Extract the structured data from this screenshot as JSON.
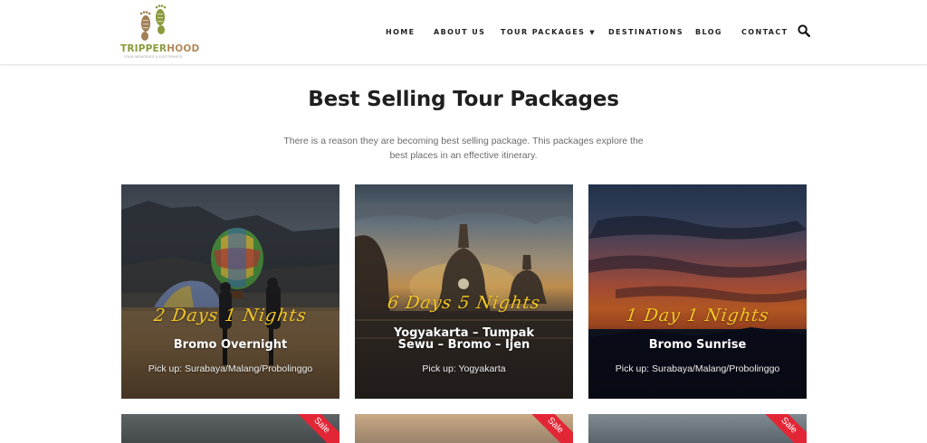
{
  "header": {
    "logo": {
      "name_part1": "TRIPPER",
      "name_part2": "HOOD",
      "tagline": "YOUR MEMORIES & FOOTPRINTS"
    },
    "nav": [
      {
        "label": "HOME"
      },
      {
        "label": "ABOUT US"
      },
      {
        "label": "TOUR PACKAGES",
        "has_dropdown": true
      },
      {
        "label": "DESTINATIONS"
      },
      {
        "label": "BLOG"
      },
      {
        "label": "CONTACT"
      }
    ],
    "search_icon": "search-icon"
  },
  "section": {
    "title": "Best Selling Tour Packages",
    "description_line1": "There is a reason they are becoming best selling package. This packages explore the",
    "description_line2": "best places in an effective itinerary."
  },
  "packages": [
    {
      "duration": "2 Days 1 Nights",
      "title_lines": [
        "Bromo Overnight"
      ],
      "pickup": "Pick up: Surabaya/Malang/Probolinggo"
    },
    {
      "duration": "6 Days 5 Nights",
      "title_lines": [
        "Yogyakarta – Tumpak",
        "Sewu – Bromo – Ijen"
      ],
      "pickup": "Pick up: Yogyakarta"
    },
    {
      "duration": "1 Day 1 Nights",
      "title_lines": [
        "Bromo Sunrise"
      ],
      "pickup": "Pick up: Surabaya/Malang/Probolinggo"
    }
  ],
  "second_row_badges": [
    "Sale",
    "Sale",
    "Sale"
  ],
  "colors": {
    "accent_yellow": "#f3c623",
    "sale_red": "#e32636",
    "heading": "#1f1f1f",
    "body_text": "#6b6b6b"
  }
}
